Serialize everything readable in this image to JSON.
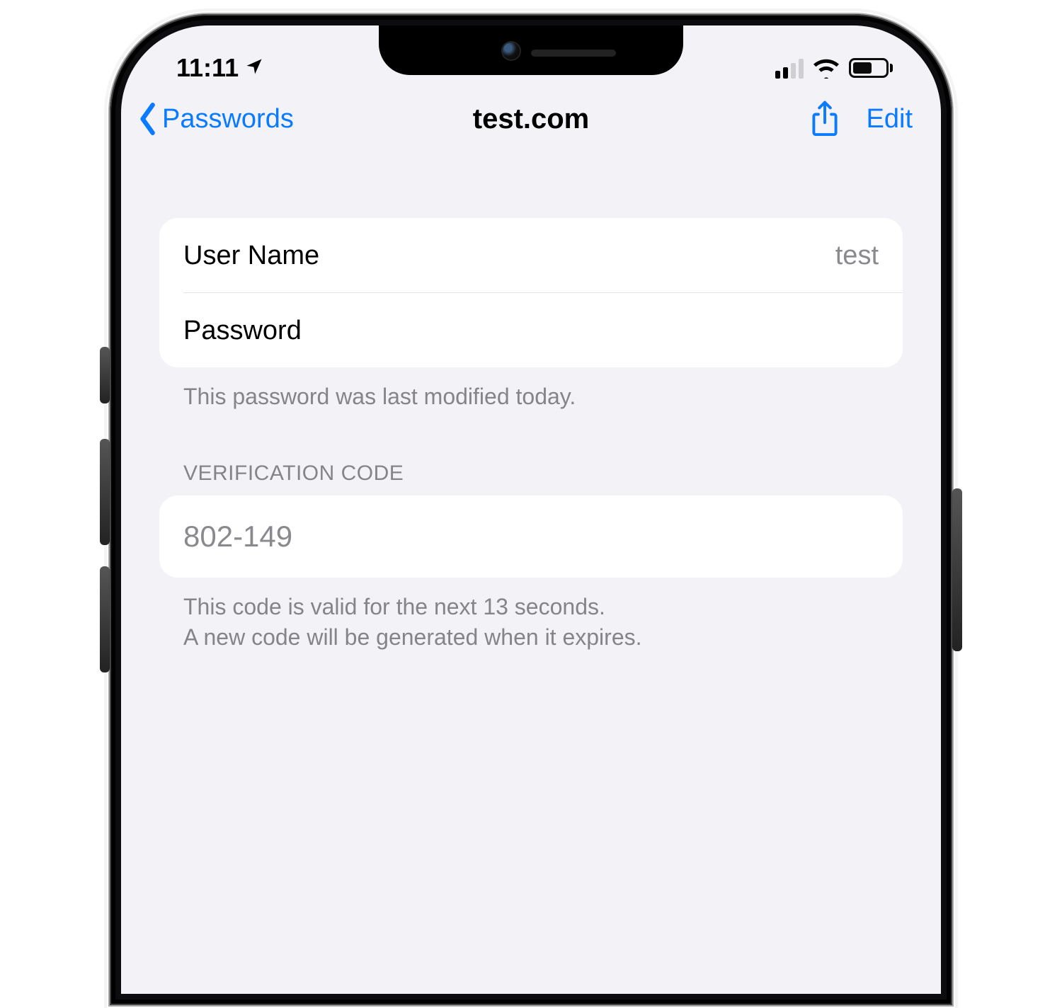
{
  "status": {
    "time": "11:11"
  },
  "nav": {
    "back_label": "Passwords",
    "title": "test.com",
    "edit_label": "Edit"
  },
  "account": {
    "username_label": "User Name",
    "username_value": "test",
    "password_label": "Password",
    "footnote": "This password was last modified today."
  },
  "verification": {
    "header": "VERIFICATION CODE",
    "code": "802-149",
    "footnote_line1": "This code is valid for the next 13 seconds.",
    "footnote_line2": "A new code will be generated when it expires."
  },
  "colors": {
    "accent": "#0a7aff",
    "bg": "#f2f2f7",
    "secondary_text": "#8a8a8e"
  }
}
